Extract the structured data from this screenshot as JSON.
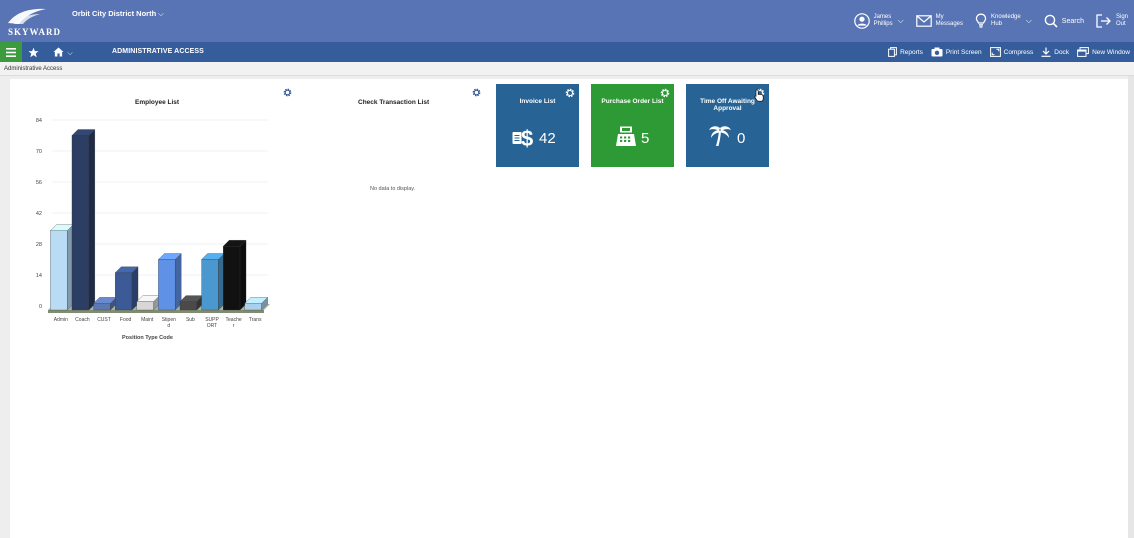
{
  "header": {
    "district": "Orbit City District North",
    "user_first": "James",
    "user_last": "Phillips",
    "messages_top": "My",
    "messages_bottom": "Messages",
    "knowledge_top": "Knowledge",
    "knowledge_bottom": "Hub",
    "search": "Search",
    "signout_top": "Sign",
    "signout_bottom": "Out",
    "logo_text": "SKYWARD"
  },
  "navbar": {
    "title": "ADMINISTRATIVE ACCESS",
    "tools": [
      "Reports",
      "Print Screen",
      "Compress",
      "Dock",
      "New Window"
    ]
  },
  "breadcrumb": "Administrative Access",
  "widgets": {
    "employee_list_title": "Employee List",
    "check_transaction_title": "Check Transaction List",
    "no_data": "No data to display.",
    "x_axis_title": "Position Type Code"
  },
  "tiles": [
    {
      "title": "Invoice List",
      "value": "42",
      "color": "#276495",
      "icon": "invoice-dollar-icon"
    },
    {
      "title": "Purchase Order List",
      "value": "5",
      "color": "#2e9a36",
      "icon": "cash-register-icon"
    },
    {
      "title": "Time Off Awaiting Approval",
      "value": "0",
      "color": "#276495",
      "icon": "palm-tree-icon"
    }
  ],
  "chart_data": {
    "type": "bar",
    "title": "Employee List",
    "xlabel": "Position Type Code",
    "ylabel": "",
    "ylim": [
      0,
      84
    ],
    "yticks": [
      0,
      14,
      28,
      42,
      56,
      70,
      84
    ],
    "categories": [
      "Admin",
      "Coach",
      "CUST",
      "Food",
      "Maint",
      "Stipend",
      "Sub",
      "SUPPORT",
      "Teacher",
      "Trans"
    ],
    "category_labels": [
      [
        "Admin"
      ],
      [
        "Coach"
      ],
      [
        "CUST"
      ],
      [
        "Food"
      ],
      [
        "Maint"
      ],
      [
        "Stipen",
        "d"
      ],
      [
        "Sub"
      ],
      [
        "SUPP",
        "ORT"
      ],
      [
        "Teache",
        "r"
      ],
      [
        "Trans"
      ]
    ],
    "values": [
      34,
      77,
      0,
      15,
      2,
      21,
      2,
      21,
      27,
      0
    ],
    "colors": [
      "#b9dcf4",
      "#2c3e63",
      "#5b78b3",
      "#3b5a96",
      "#d7d7d7",
      "#5f91e6",
      "#4a4a4a",
      "#4b98cf",
      "#111111",
      "#a9d0ec"
    ],
    "grid": true,
    "legend": "none"
  }
}
